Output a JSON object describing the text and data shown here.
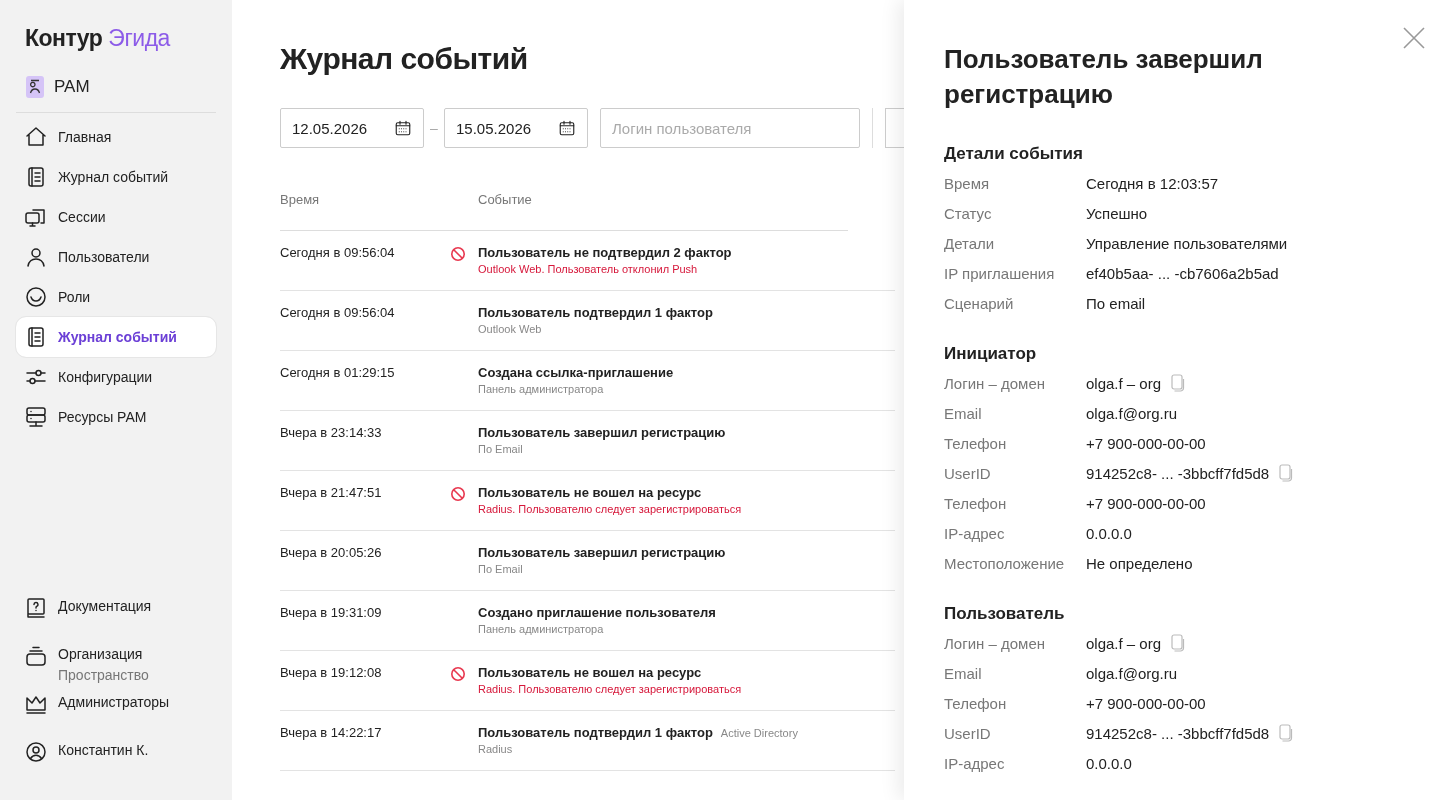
{
  "logo": {
    "name": "Контур",
    "product": "Эгида"
  },
  "workspace": {
    "label": "PAM"
  },
  "nav": [
    {
      "label": "Главная",
      "selected": false
    },
    {
      "label": "Журнал событий",
      "selected": false
    },
    {
      "label": "Сессии",
      "selected": false
    },
    {
      "label": "Пользователи",
      "selected": false
    },
    {
      "label": "Роли",
      "selected": false
    },
    {
      "label": "Журнал событий",
      "selected": true
    },
    {
      "label": "Конфигурации",
      "selected": false
    },
    {
      "label": "Ресурсы PAM",
      "selected": false
    }
  ],
  "footer_nav": [
    {
      "label": "Документация"
    },
    {
      "label": "Организация",
      "sublabel": "Пространство"
    },
    {
      "label": "Администраторы"
    },
    {
      "label": "Константин К."
    }
  ],
  "page_title": "Журнал событий",
  "filters": {
    "date_from": "12.05.2026",
    "date_to": "15.05.2026",
    "separator": "–",
    "login_placeholder": "Логин пользователя"
  },
  "table": {
    "columns": [
      "Время",
      "Событие"
    ],
    "rows": [
      {
        "time": "Сегодня в 09:56:04",
        "event": "Пользователь не подтвердил 2 фактор",
        "details": "Outlook Web. Пользователь отклонил Push",
        "error": true
      },
      {
        "time": "Сегодня в 09:56:04",
        "event": "Пользователь подтвердил 1 фактор",
        "details": "Outlook Web",
        "error": false
      },
      {
        "time": "Сегодня в 01:29:15",
        "event": "Создана ссылка-приглашение",
        "details": "Панель администратора",
        "error": false
      },
      {
        "time": "Вчера в 23:14:33",
        "event": "Пользователь завершил регистрацию",
        "details": "По Email",
        "error": false
      },
      {
        "time": "Вчера в 21:47:51",
        "event": "Пользователь не вошел на ресурс",
        "details": "Radius. Пользователю следует зарегистрироваться",
        "error": true
      },
      {
        "time": "Вчера в 20:05:26",
        "event": "Пользователь завершил регистрацию",
        "details": "По Email",
        "error": false
      },
      {
        "time": "Вчера в 19:31:09",
        "event": "Создано приглашение пользователя",
        "details": "Панель администратора",
        "error": false
      },
      {
        "time": "Вчера в 19:12:08",
        "event": "Пользователь не вошел на ресурс",
        "details": "Radius. Пользователю следует зарегистрироваться",
        "error": true
      },
      {
        "time": "Вчера в 14:22:17",
        "event": "Пользователь подтвердил 1 фактор",
        "tag": "Active Directory",
        "details": "Radius",
        "error": false
      }
    ]
  },
  "drawer": {
    "title": "Пользователь завершил регистрацию",
    "sections": [
      {
        "heading": "Детали события",
        "fields": [
          {
            "label": "Время",
            "value": "Сегодня в 12:03:57",
            "copyable": false
          },
          {
            "label": "Статус",
            "value": "Успешно",
            "copyable": false
          },
          {
            "label": "Детали",
            "value": "Управление пользователями",
            "copyable": false
          },
          {
            "label": "IP приглашения",
            "value": "ef40b5aa- ... -cb7606a2b5ad",
            "copyable": false
          },
          {
            "label": "Сценарий",
            "value": "По email",
            "copyable": false
          }
        ]
      },
      {
        "heading": "Инициатор",
        "fields": [
          {
            "label": "Логин – домен",
            "value": "olga.f – org",
            "copyable": true
          },
          {
            "label": "Email",
            "value": "olga.f@org.ru",
            "copyable": false
          },
          {
            "label": "Телефон",
            "value": "+7 900-000-00-00",
            "copyable": false
          },
          {
            "label": "UserID",
            "value": "914252c8- ... -3bbcff7fd5d8",
            "copyable": true
          },
          {
            "label": "Телефон",
            "value": "+7 900-000-00-00",
            "copyable": false
          },
          {
            "label": "IP-адрес",
            "value": "0.0.0.0",
            "copyable": false
          },
          {
            "label": "Местоположение",
            "value": "Не определено",
            "copyable": false
          }
        ]
      },
      {
        "heading": "Пользователь",
        "fields": [
          {
            "label": "Логин – домен",
            "value": "olga.f – org",
            "copyable": true
          },
          {
            "label": "Email",
            "value": "olga.f@org.ru",
            "copyable": false
          },
          {
            "label": "Телефон",
            "value": "+7 900-000-00-00",
            "copyable": false
          },
          {
            "label": "UserID",
            "value": "914252c8- ... -3bbcff7fd5d8",
            "copyable": true
          },
          {
            "label": "IP-адрес",
            "value": "0.0.0.0",
            "copyable": false
          }
        ]
      }
    ]
  }
}
